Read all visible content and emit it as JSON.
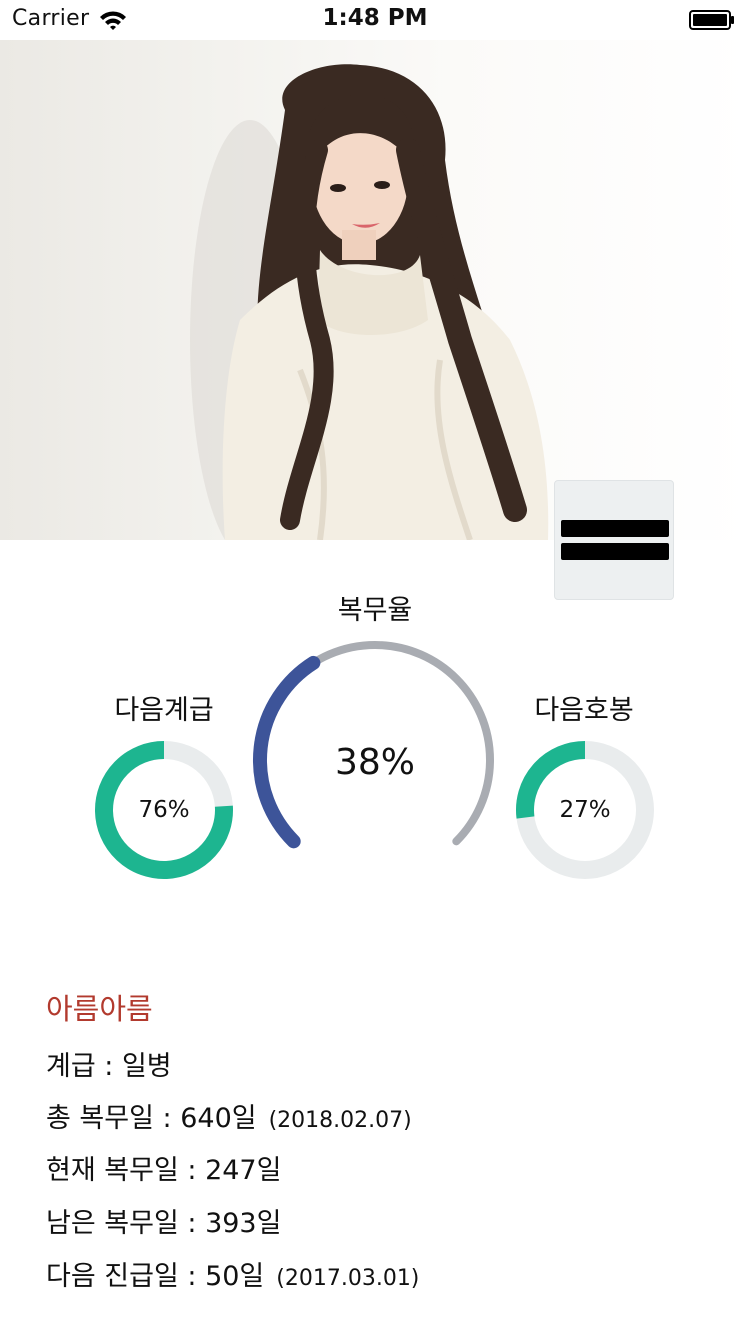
{
  "status_bar": {
    "carrier": "Carrier",
    "time": "1:48 PM"
  },
  "hero": {
    "image": "profile-photo"
  },
  "menu": {
    "icon": "hamburger-menu-icon"
  },
  "gauges": {
    "next_rank": {
      "title": "다음계급",
      "value": 0.76,
      "label": "76%",
      "color": "#1db590"
    },
    "service_rate": {
      "title": "복무율",
      "value": 0.38,
      "label": "38%",
      "color": "#3d5499",
      "track_color": "#a9acb2"
    },
    "next_step": {
      "title": "다음호봉",
      "value": 0.27,
      "label": "27%",
      "color": "#1db590"
    },
    "track_color": "#e9eced"
  },
  "profile": {
    "name": "아름아름",
    "rank_label": "계급",
    "rank_value": "일병",
    "total_label": "총 복무일",
    "total_value": "640일",
    "total_date": "(2018.02.07)",
    "current_label": "현재 복무일",
    "current_value": "247일",
    "remaining_label": "남은 복무일",
    "remaining_value": "393일",
    "promotion_label": "다음 진급일",
    "promotion_value": "50일",
    "promotion_date": "(2017.03.01)"
  },
  "colors": {
    "name": "#b23a2e",
    "accent_green": "#1db590",
    "accent_blue": "#3d5499"
  }
}
